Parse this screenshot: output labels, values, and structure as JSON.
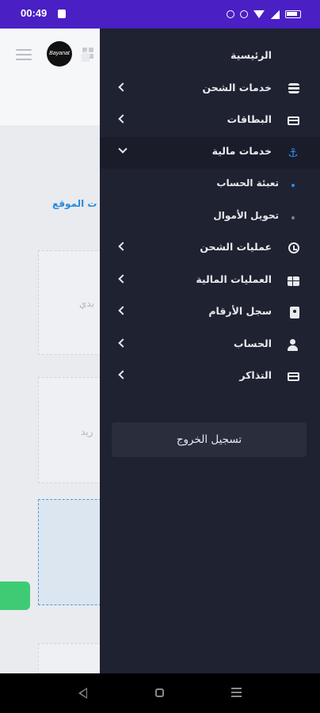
{
  "status_bar": {
    "time": "00:49"
  },
  "background_page": {
    "logo_text": "Bayanat",
    "link_text": "ت الموقع",
    "card_1_text": "بدي",
    "card_2_text": "ريد"
  },
  "drawer": {
    "items": [
      {
        "label": "الرئيسية",
        "icon": "home-icon",
        "expandable": false
      },
      {
        "label": "خدمات الشحن",
        "icon": "coins-icon",
        "expandable": true
      },
      {
        "label": "البطاقات",
        "icon": "credit-card-icon",
        "expandable": true
      },
      {
        "label": "خدمات مالية",
        "icon": "anchor-icon",
        "expandable": true,
        "expanded": true
      },
      {
        "label": "عمليات الشحن",
        "icon": "history-icon",
        "expandable": true
      },
      {
        "label": "العمليات المالية",
        "icon": "table-icon",
        "expandable": true
      },
      {
        "label": "سجل الأرقام",
        "icon": "contact-book-icon",
        "expandable": true
      },
      {
        "label": "الحساب",
        "icon": "user-icon",
        "expandable": true
      },
      {
        "label": "التذاكر",
        "icon": "ticket-icon",
        "expandable": true
      }
    ],
    "sub_items": [
      {
        "label": "تعبئة الحساب",
        "active": true
      },
      {
        "label": "تحويل الأموال",
        "active": false
      }
    ],
    "logout_label": "تسجيل الخروج"
  },
  "colors": {
    "status_bar": "#4a1fc4",
    "drawer_bg": "#1f2230",
    "accent": "#2b8cff",
    "link": "#2a8be0",
    "green_button": "#3fcb74"
  }
}
